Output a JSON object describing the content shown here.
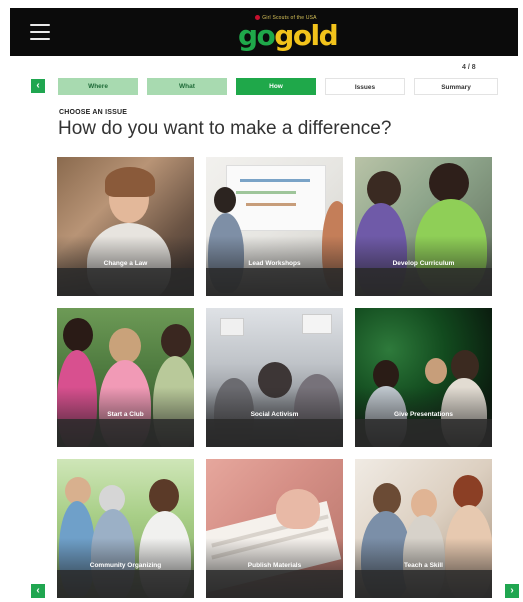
{
  "header": {
    "logo_small": "Girl Scouts of the USA",
    "logo_go": "go",
    "logo_gold": "gold"
  },
  "progress": {
    "label": "4 / 8"
  },
  "steps": [
    {
      "label": "Where",
      "state": "done"
    },
    {
      "label": "What",
      "state": "done"
    },
    {
      "label": "How",
      "state": "current"
    },
    {
      "label": "Issues",
      "state": "future"
    },
    {
      "label": "Summary",
      "state": "future"
    }
  ],
  "section": {
    "eyebrow": "CHOOSE AN ISSUE",
    "heading": "How do you want to make a difference?"
  },
  "cards": [
    {
      "label": "Change a Law"
    },
    {
      "label": "Lead Workshops"
    },
    {
      "label": "Develop Curriculum"
    },
    {
      "label": "Start a Club"
    },
    {
      "label": "Social Activism"
    },
    {
      "label": "Give Presentations"
    },
    {
      "label": "Community Organizing"
    },
    {
      "label": "Publish Materials"
    },
    {
      "label": "Teach a Skill"
    }
  ],
  "icons": {
    "menu": "hamburger-menu-icon",
    "prev": "chevron-left-icon",
    "next": "chevron-right-icon"
  },
  "colors": {
    "accent": "#1fa84a",
    "accent_light": "#a8dab0",
    "header_bg": "#0b0b0b",
    "gold": "#f2c31b"
  }
}
